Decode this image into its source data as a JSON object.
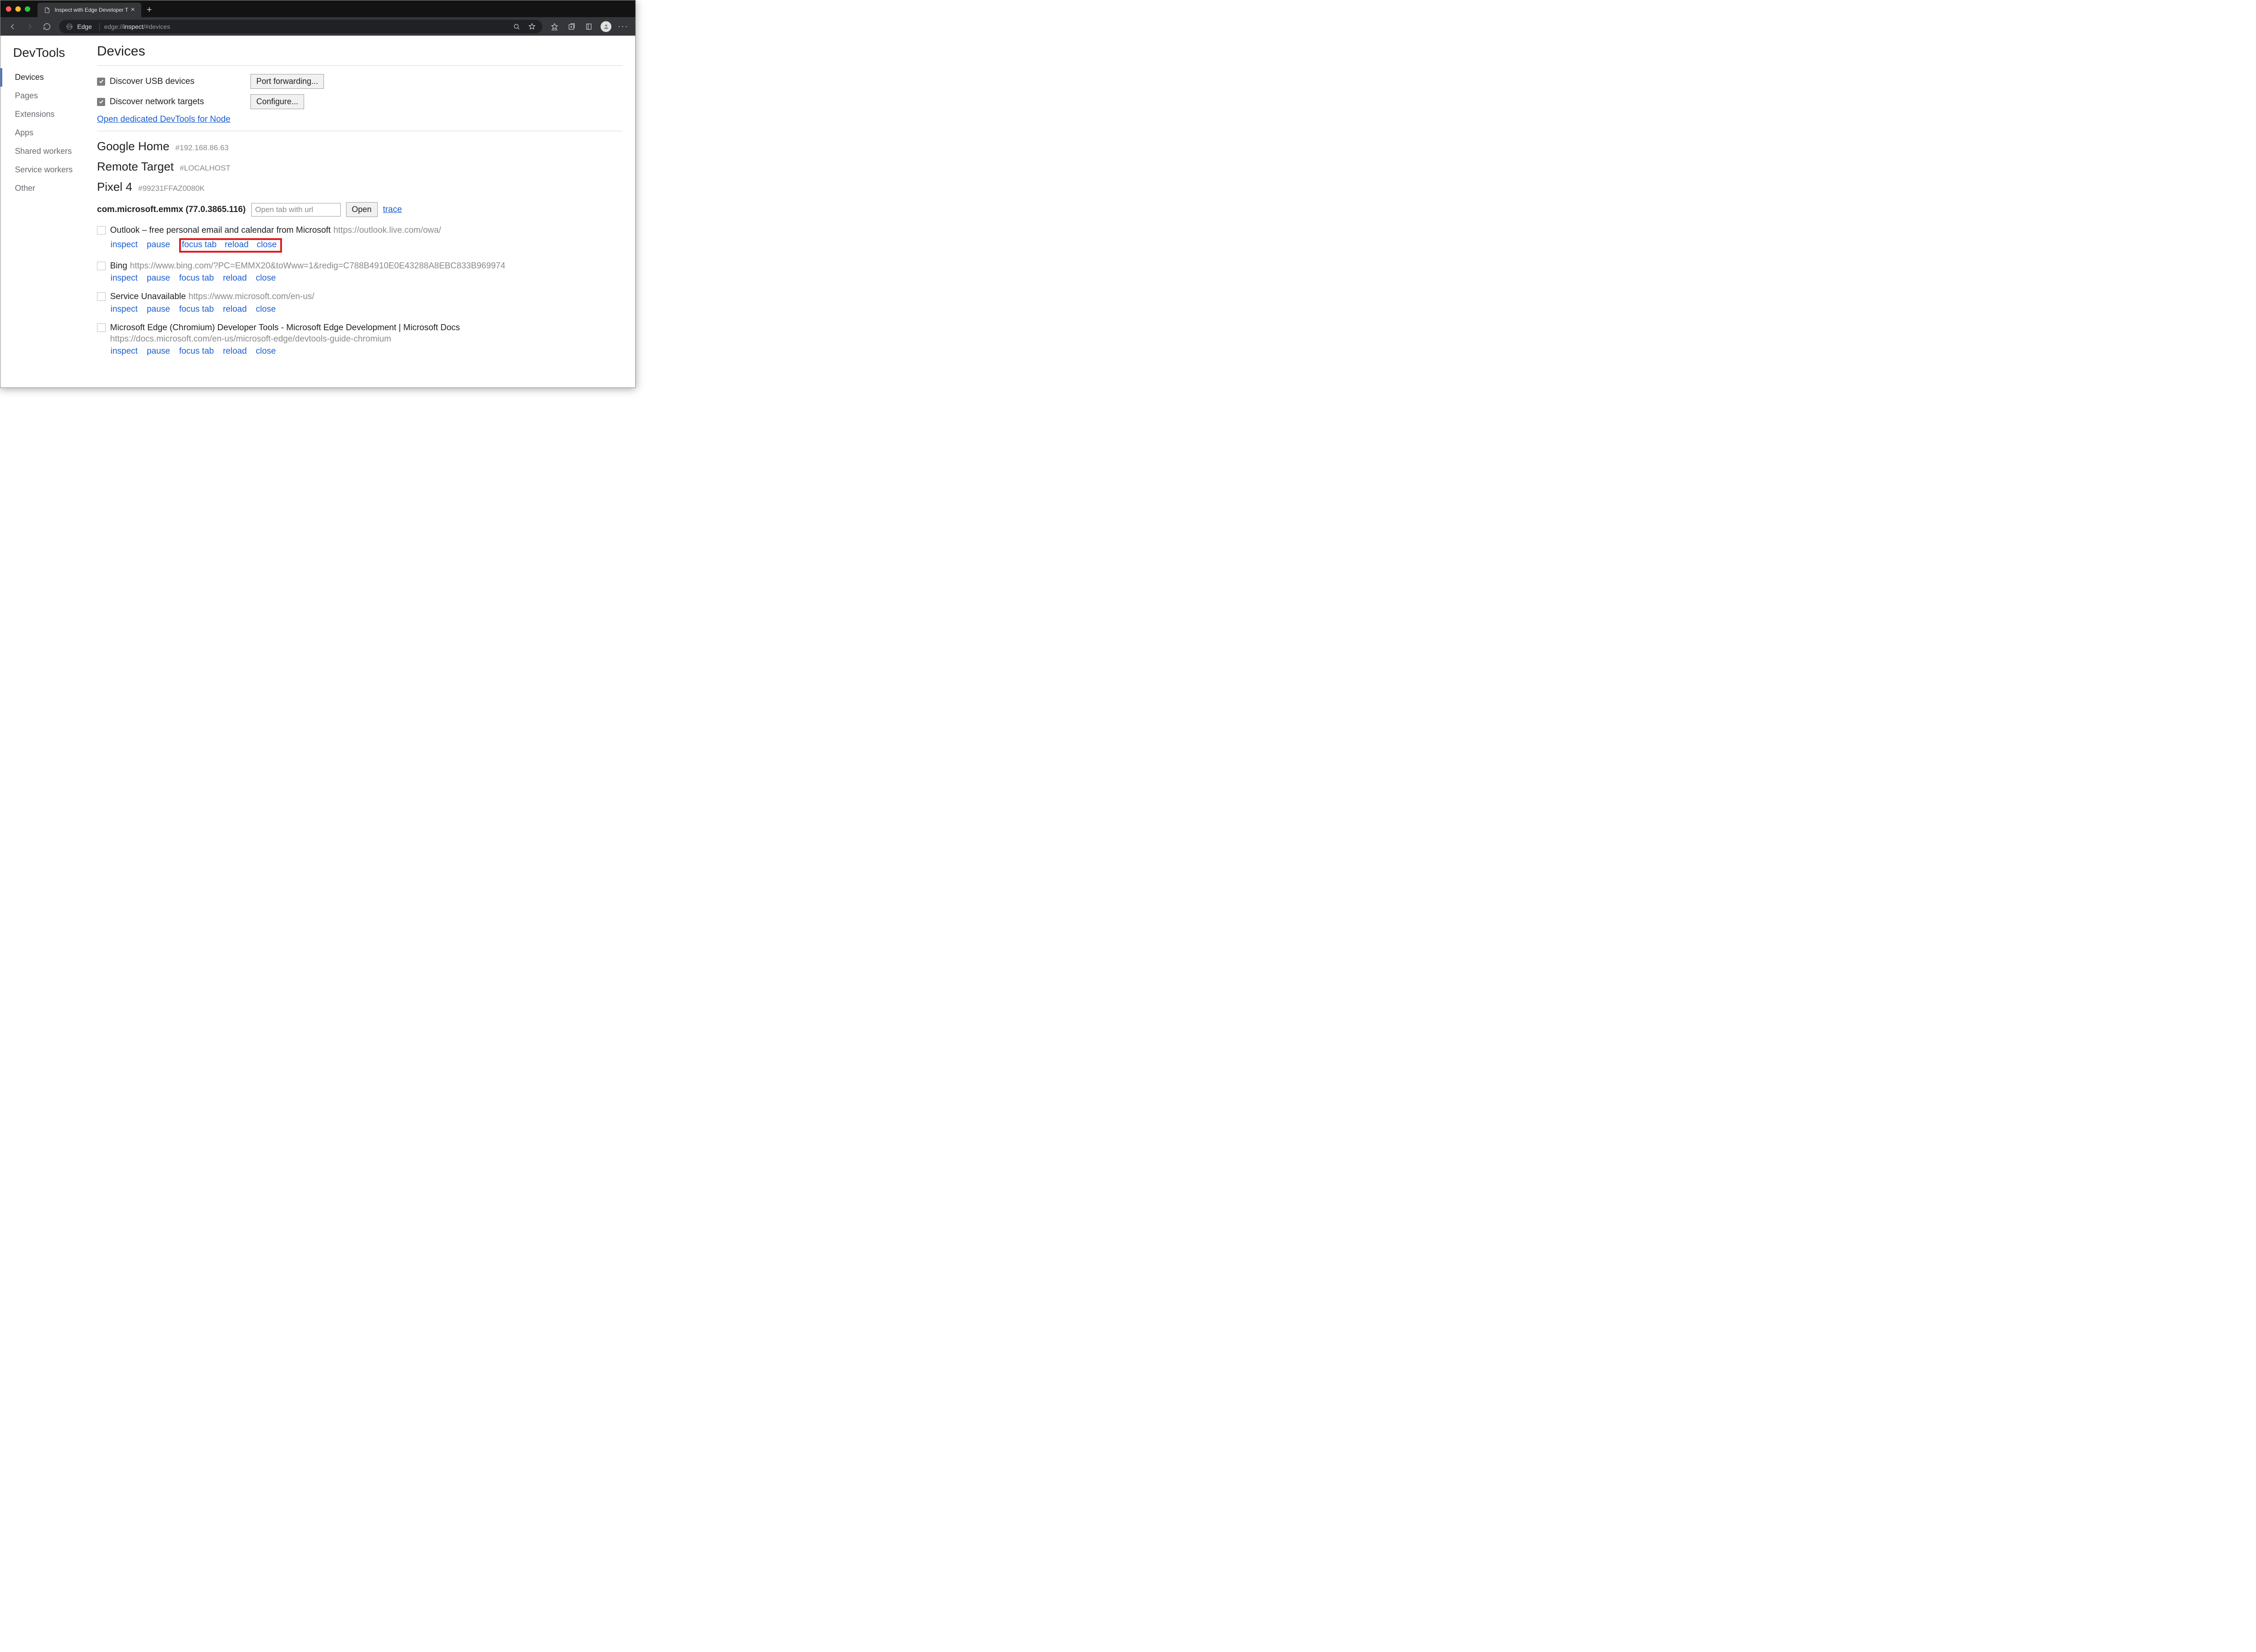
{
  "window": {
    "tab_title": "Inspect with Edge Developer T",
    "address_app_label": "Edge",
    "address_url_dim": "edge://",
    "address_url_bright": "inspect",
    "address_url_tail": "/#devices"
  },
  "sidebar": {
    "title": "DevTools",
    "items": [
      "Devices",
      "Pages",
      "Extensions",
      "Apps",
      "Shared workers",
      "Service workers",
      "Other"
    ],
    "active_index": 0
  },
  "page": {
    "title": "Devices",
    "discover": [
      {
        "label": "Discover USB devices",
        "button": "Port forwarding..."
      },
      {
        "label": "Discover network targets",
        "button": "Configure..."
      }
    ],
    "node_link": "Open dedicated DevTools for Node",
    "devices": [
      {
        "name": "Google Home",
        "sub": "#192.168.86.63"
      },
      {
        "name": "Remote Target",
        "sub": "#LOCALHOST"
      },
      {
        "name": "Pixel 4",
        "sub": "#99231FFAZ0080K"
      }
    ],
    "browser": {
      "name": "com.microsoft.emmx (77.0.3865.116)",
      "input_placeholder": "Open tab with url",
      "open_btn": "Open",
      "trace_link": "trace"
    },
    "action_labels": {
      "inspect": "inspect",
      "pause": "pause",
      "focus": "focus tab",
      "reload": "reload",
      "close": "close"
    },
    "targets": [
      {
        "title": "Outlook – free personal email and calendar from Microsoft",
        "url": "https://outlook.live.com/owa/",
        "highlight": true
      },
      {
        "title": "Bing",
        "url": "https://www.bing.com/?PC=EMMX20&toWww=1&redig=C788B4910E0E43288A8EBC833B969974",
        "highlight": false
      },
      {
        "title": "Service Unavailable",
        "url": "https://www.microsoft.com/en-us/",
        "highlight": false
      },
      {
        "title": "Microsoft Edge (Chromium) Developer Tools - Microsoft Edge Development | Microsoft Docs",
        "url": "https://docs.microsoft.com/en-us/microsoft-edge/devtools-guide-chromium",
        "highlight": false,
        "url_below": true
      }
    ]
  }
}
